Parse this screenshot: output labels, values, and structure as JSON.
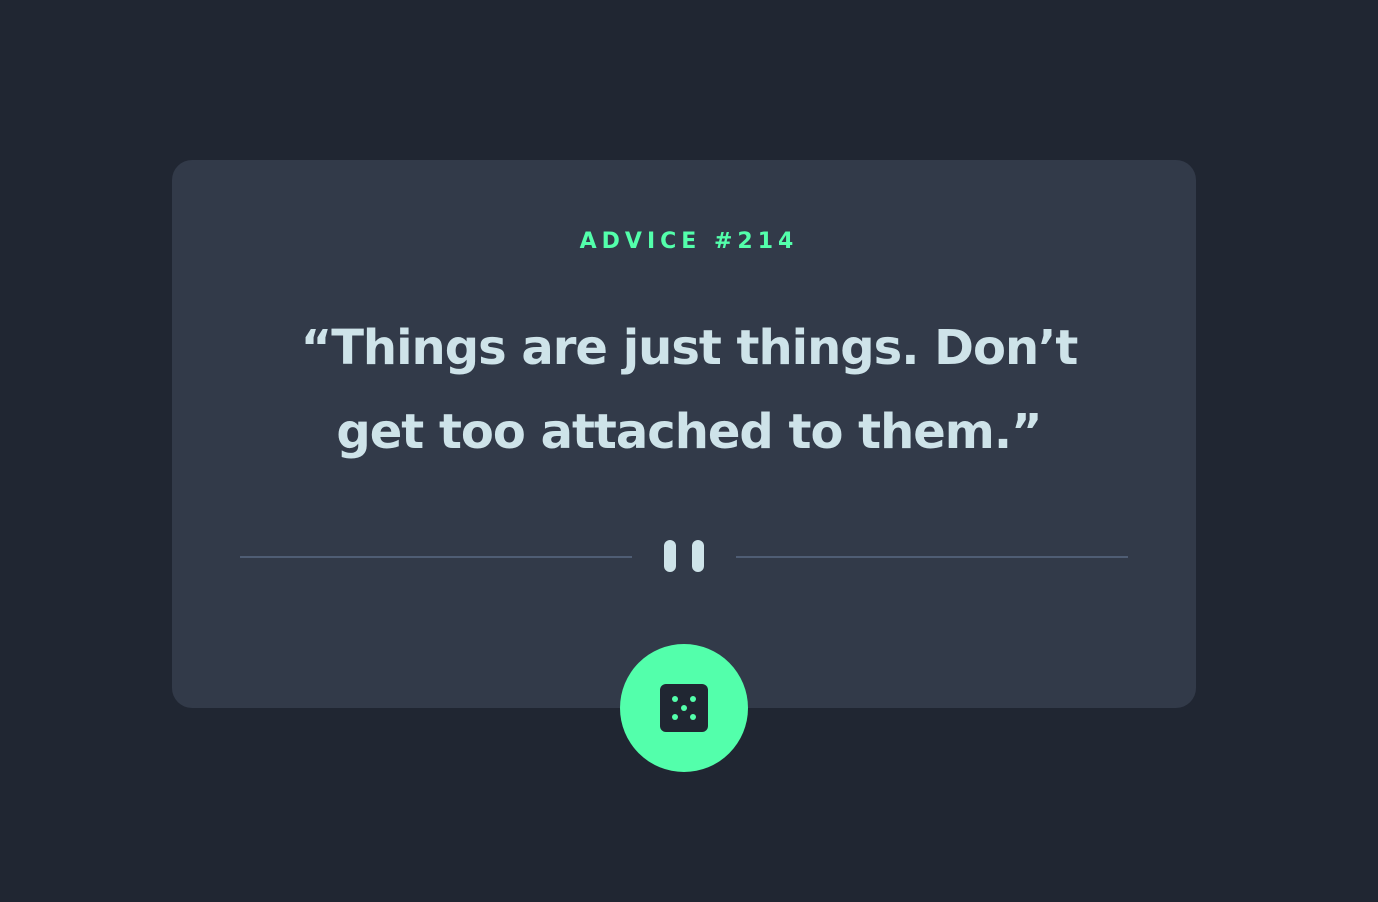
{
  "advice": {
    "label": "ADVICE #214",
    "quote": "“Things are just things. Don’t get too attached to them.”"
  },
  "icons": {
    "divider": "pause-icon",
    "button": "dice-icon"
  },
  "colors": {
    "background": "#202632",
    "card": "#323a49",
    "accent": "#53ffab",
    "text": "#cee3e9",
    "divider": "#4f5d74"
  }
}
